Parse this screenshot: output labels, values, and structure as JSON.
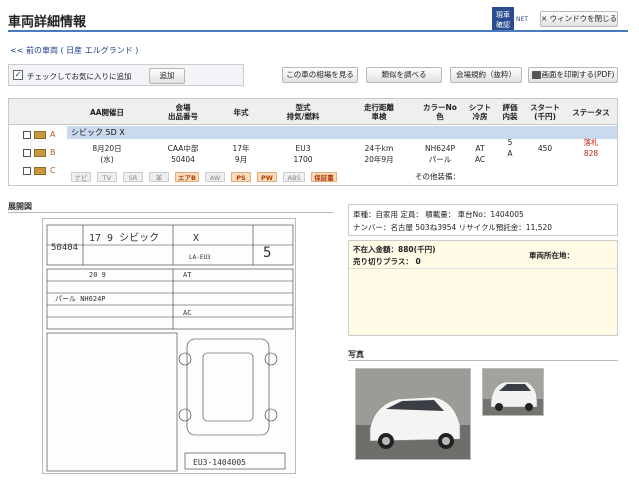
{
  "header": {
    "title": "車両詳細情報",
    "logo_text": "現車\n確認",
    "logo_sub": "NET",
    "close_label": "× ウィンドウを閉じる"
  },
  "nav": {
    "back_link": "<< 前の車両 ( 日産 エルグランド )"
  },
  "favorites": {
    "checkbox_label": "チェックしてお気に入りに追加",
    "add_label": "追加"
  },
  "actions": {
    "market": "この車の相場を見る",
    "similar": "類似を調べる",
    "terms": "会場規約（抜粋）",
    "print": "画面を印刷する(PDF)"
  },
  "table": {
    "headers": [
      "AA開催日",
      "会場\n出品番号",
      "年式",
      "型式\n排気/燃料",
      "走行距離\n車検",
      "カラーNo\n色",
      "シフト\n冷房",
      "評価\n内装",
      "スタート\n(千円)",
      "ステータス"
    ],
    "model": "シビック 5D X",
    "row": {
      "date": "8月20日",
      "weekday": "(水)",
      "venue": "CAA中部",
      "lot": "50404",
      "year": "17年",
      "month": "9月",
      "type": "EU3",
      "cc": "1700",
      "mileage": "24千km",
      "inspection": "20年9月",
      "color_no": "NH624P",
      "color": "パール",
      "shift": "AT",
      "ac": "AC",
      "grade": "5",
      "interior": "A",
      "start": "450",
      "status": "落札",
      "status_price": "828"
    },
    "row_labels": [
      "A",
      "B",
      "C"
    ],
    "equipment": [
      "ナビ",
      "TV",
      "SR",
      "革",
      "エアB",
      "AW",
      "PS",
      "PW",
      "ABS",
      "保証書"
    ],
    "equipment_active": [
      false,
      false,
      false,
      false,
      true,
      false,
      true,
      true,
      false,
      true
    ],
    "other_label": "その他装備："
  },
  "sheet_section": {
    "title": "展開図"
  },
  "info": {
    "line1": "車種：自家用  定員：       積載量：     車台No：1404005",
    "line2": "ナンバー：名古屋 503ね3954  リサイクル預託金：11,520"
  },
  "price": {
    "unsold_label": "不在入金額：880(千円)",
    "sell_plus_label": "売り切りプラス：  0",
    "location_label": "車両所在地："
  },
  "photos": {
    "title": "写真"
  },
  "colors": {
    "accent": "#4a7bbd",
    "model_row": "#c9d9ee",
    "status": "#c2251a"
  }
}
